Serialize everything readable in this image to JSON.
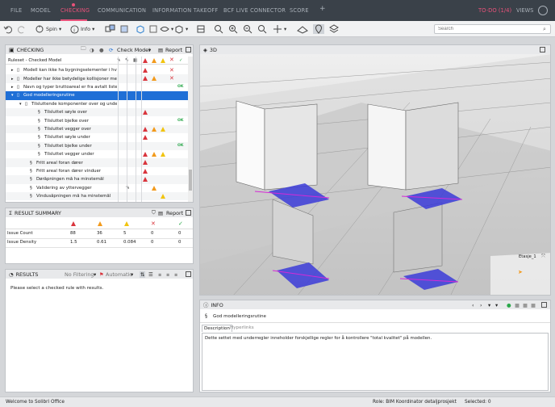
{
  "menubar": {
    "items": [
      "FILE",
      "MODEL",
      "CHECKING",
      "COMMUNICATION",
      "INFORMATION TAKEOFF",
      "BCF LIVE CONNECTOR",
      "SCORE"
    ],
    "add": "+",
    "todo": "TO-DO (1/4)",
    "views": "VIEWS"
  },
  "toolbar": {
    "spin": "Spin",
    "info": "Info",
    "search_placeholder": "Search"
  },
  "checking": {
    "title": "CHECKING",
    "check_model": "Check Model",
    "report": "Report",
    "ruleset": "Ruleset - Checked Model",
    "rows": [
      {
        "label": "Modell kan ikke ha bygningselementer i hv"
      },
      {
        "label": "Modeller har ikke betydelige kollisjoner me"
      },
      {
        "label": "Navn og typer bruttoareal er fra avtalt liste"
      },
      {
        "label": "God modelleringsrutine"
      },
      {
        "label": "Tilsluttende komponenter over og unde"
      },
      {
        "label": "Tilsluttet søyle over"
      },
      {
        "label": "Tilsluttet bjelke over"
      },
      {
        "label": "Tilsluttet vegger over"
      },
      {
        "label": "Tilsluttet søyle under"
      },
      {
        "label": "Tilsluttet bjelke under"
      },
      {
        "label": "Tilsluttet vegger under"
      },
      {
        "label": "Fritt areal foran dører"
      },
      {
        "label": "Fritt areal foran dører vinduer"
      },
      {
        "label": "Døråpningen må ha minstemål"
      },
      {
        "label": "Validering av yttervegger"
      },
      {
        "label": "Vindusåpningen må ha minstemål"
      }
    ],
    "ok_label": "OK"
  },
  "result_summary": {
    "title": "RESULT SUMMARY",
    "report": "Report",
    "rows": [
      {
        "label": "Issue Count",
        "values": [
          "88",
          "36",
          "5",
          "0",
          "0"
        ]
      },
      {
        "label": "Issue Density",
        "values": [
          "1.5",
          "0.61",
          "0.084",
          "0",
          "0"
        ]
      }
    ]
  },
  "results": {
    "title": "RESULTS",
    "filter": "No Filtering",
    "mode": "Automatic",
    "message": "Please select a checked rule with results."
  },
  "view3d": {
    "title": "3D",
    "label": "Etasje_1"
  },
  "info": {
    "title": "INFO",
    "item": "God modelleringsrutine",
    "tabs": [
      "Description",
      "Hyperlinks"
    ],
    "description": "Dette settet med underregler inneholder forskjellige regler for å kontrollere \"total kvalitet\" på modellen."
  },
  "statusbar": {
    "welcome": "Welcome to Solibri Office",
    "role": "Role: BIM Koordinator detaljprosjekt",
    "selected": "Selected: 0"
  },
  "colors": {
    "accent": "#e8527a",
    "select": "#1f6fd6",
    "red": "#d9343c",
    "orange": "#f29a1c",
    "yellow": "#f1c40f",
    "green": "#2aa84a"
  }
}
